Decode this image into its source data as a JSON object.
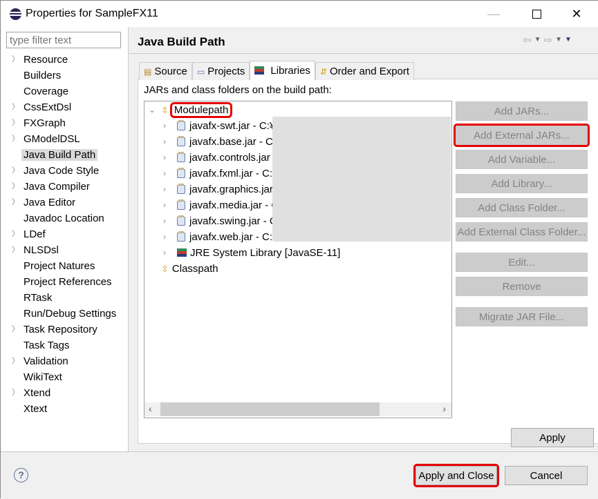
{
  "window": {
    "title": "Properties for SampleFX11",
    "minimize": "—",
    "close": "✕"
  },
  "filter": {
    "placeholder": "type filter text",
    "value": ""
  },
  "sidebar": {
    "items": [
      {
        "label": "Resource",
        "expandable": true
      },
      {
        "label": "Builders",
        "expandable": false
      },
      {
        "label": "Coverage",
        "expandable": false
      },
      {
        "label": "CssExtDsl",
        "expandable": true
      },
      {
        "label": "FXGraph",
        "expandable": true
      },
      {
        "label": "GModelDSL",
        "expandable": true
      },
      {
        "label": "Java Build Path",
        "expandable": false,
        "selected": true
      },
      {
        "label": "Java Code Style",
        "expandable": true
      },
      {
        "label": "Java Compiler",
        "expandable": true
      },
      {
        "label": "Java Editor",
        "expandable": true
      },
      {
        "label": "Javadoc Location",
        "expandable": false
      },
      {
        "label": "LDef",
        "expandable": true
      },
      {
        "label": "NLSDsl",
        "expandable": true
      },
      {
        "label": "Project Natures",
        "expandable": false
      },
      {
        "label": "Project References",
        "expandable": false
      },
      {
        "label": "RTask",
        "expandable": false
      },
      {
        "label": "Run/Debug Settings",
        "expandable": false
      },
      {
        "label": "Task Repository",
        "expandable": true
      },
      {
        "label": "Task Tags",
        "expandable": false
      },
      {
        "label": "Validation",
        "expandable": true
      },
      {
        "label": "WikiText",
        "expandable": false
      },
      {
        "label": "Xtend",
        "expandable": true
      },
      {
        "label": "Xtext",
        "expandable": false
      }
    ]
  },
  "page": {
    "title": "Java Build Path"
  },
  "tabs": [
    {
      "label": "Source",
      "icon": "source-folder-icon"
    },
    {
      "label": "Projects",
      "icon": "projects-folder-icon"
    },
    {
      "label": "Libraries",
      "icon": "libraries-icon",
      "active": true
    },
    {
      "label": "Order and Export",
      "icon": "order-export-icon"
    }
  ],
  "libraries": {
    "description": "JARs and class folders on the build path:",
    "tree": {
      "modulepath": "Modulepath",
      "jars": [
        "javafx-swt.jar - C:¥",
        "javafx.base.jar - C:",
        "javafx.controls.jar",
        "javafx.fxml.jar - C:¥",
        "javafx.graphics.jar",
        "javafx.media.jar - C",
        "javafx.swing.jar - C",
        "javafx.web.jar - C:¥"
      ],
      "jre": "JRE System Library [JavaSE-11]",
      "classpath": "Classpath"
    },
    "buttons": {
      "add_jars": "Add JARs...",
      "add_external_jars": "Add External JARs...",
      "add_variable": "Add Variable...",
      "add_library": "Add Library...",
      "add_class_folder": "Add Class Folder...",
      "add_external_class_folder": "Add External Class Folder...",
      "edit": "Edit...",
      "remove": "Remove",
      "migrate": "Migrate JAR File..."
    }
  },
  "footer": {
    "apply": "Apply",
    "apply_close": "Apply and Close",
    "cancel": "Cancel",
    "help": "?"
  }
}
